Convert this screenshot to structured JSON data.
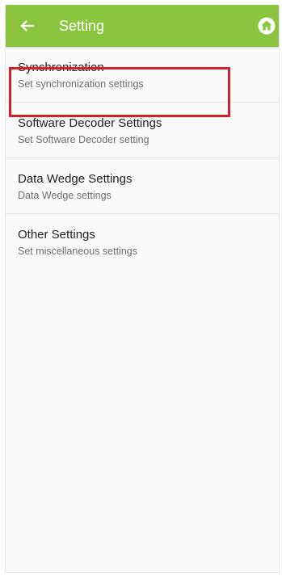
{
  "app_bar": {
    "title": "Setting",
    "back_icon": "back-arrow-icon",
    "home_icon": "home-icon",
    "color": "#8bc53f"
  },
  "settings": [
    {
      "title": "Synchronization",
      "subtitle": "Set synchronization settings"
    },
    {
      "title": "Software Decoder Settings",
      "subtitle": "Set Software Decoder setting"
    },
    {
      "title": "Data Wedge Settings",
      "subtitle": "Data Wedge settings"
    },
    {
      "title": "Other Settings",
      "subtitle": "Set miscellaneous settings"
    }
  ],
  "highlight": {
    "item": "Software Decoder Settings",
    "color": "#d71f2a"
  }
}
